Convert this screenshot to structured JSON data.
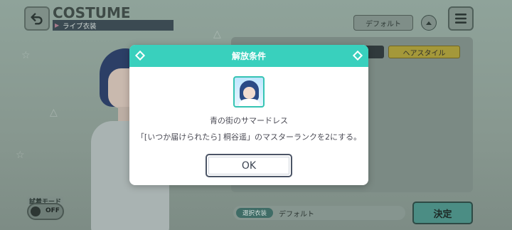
{
  "header": {
    "title": "COSTUME",
    "subtitle": "ライブ衣装"
  },
  "top_controls": {
    "default_label": "デフォルト"
  },
  "tabs": {
    "hair_style": "ヘアスタイル"
  },
  "trial_mode": {
    "label": "試着モード",
    "state": "OFF"
  },
  "selected": {
    "tag": "選択衣装",
    "value": "デフォルト"
  },
  "decide_label": "決定",
  "dialog": {
    "title": "解放条件",
    "item_name": "青の街のサマードレス",
    "condition": "「[いつか届けられたら] 桐谷遥」のマスターランクを2にする。",
    "ok_label": "OK"
  },
  "colors": {
    "accent": "#39d0bd",
    "dialog_bg": "#ffffff",
    "decide_button": "#4b8d84"
  },
  "icons": [
    "back-arrow-icon",
    "menu-icon",
    "chevron-up-icon",
    "diamond-icon"
  ]
}
